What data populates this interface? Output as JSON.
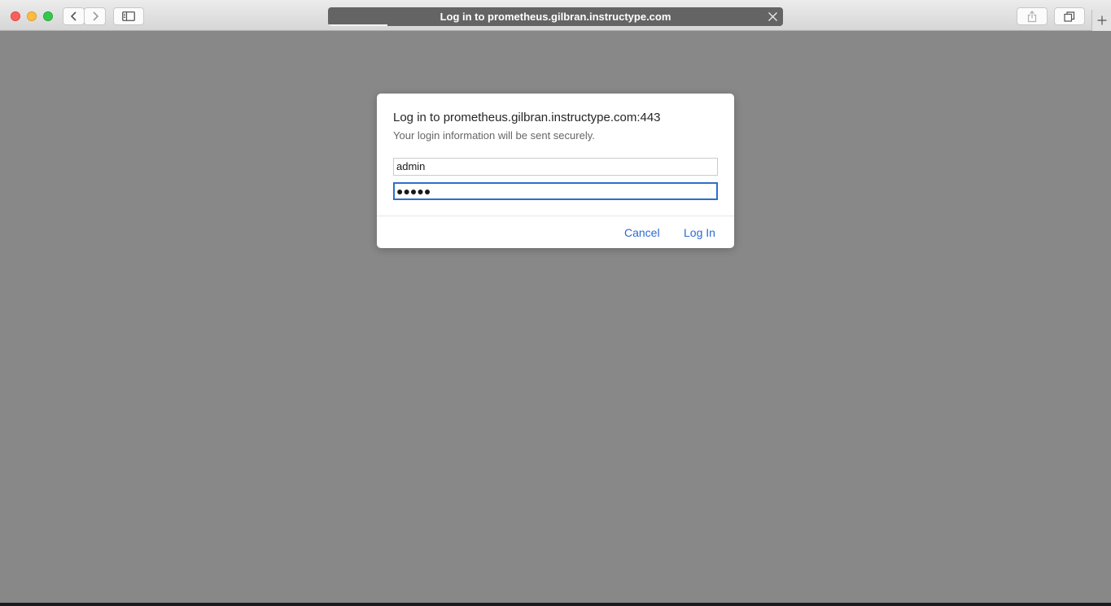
{
  "browser": {
    "tab_title": "Log in to prometheus.gilbran.instructype.com",
    "load_progress": 0.13
  },
  "dialog": {
    "title": "Log in to prometheus.gilbran.instructype.com:443",
    "subtitle": "Your login information will be sent securely.",
    "username": "admin",
    "password_mask": "●●●●●",
    "cancel_label": "Cancel",
    "login_label": "Log In"
  },
  "colors": {
    "accent": "#2c6ad4",
    "focus_ring": "#2f6fc8",
    "page_overlay": "#888888"
  },
  "icons": [
    "back-icon",
    "forward-icon",
    "sidebar-icon",
    "close-icon",
    "share-icon",
    "tabs-overview-icon",
    "plus-icon"
  ]
}
